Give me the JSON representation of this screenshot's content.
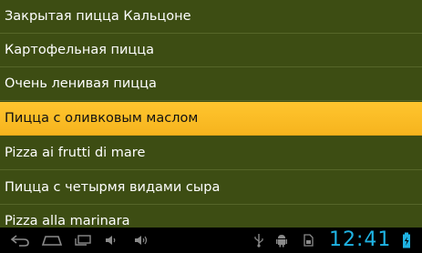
{
  "list": {
    "items": [
      {
        "label": "Закрытая пицца Кальцоне",
        "selected": false
      },
      {
        "label": "Картофельная пицца",
        "selected": false
      },
      {
        "label": "Очень ленивая пицца",
        "selected": false
      },
      {
        "label": "Пицца с оливковым маслом",
        "selected": true
      },
      {
        "label": "Pizza ai frutti di mare",
        "selected": false
      },
      {
        "label": "Пицца с четырмя видами сыра",
        "selected": false
      },
      {
        "label": "Pizza alla marinara",
        "selected": false
      }
    ]
  },
  "navbar": {
    "buttons": [
      "back-icon",
      "home-icon",
      "recent-apps-icon",
      "volume-down-icon",
      "volume-up-icon"
    ],
    "status_icons": [
      "usb-icon",
      "android-debug-icon",
      "sd-card-icon"
    ],
    "clock": "12:41",
    "battery": "battery-charging-icon"
  },
  "colors": {
    "list_background": "#3d4d13",
    "selected_background": "#fbbd26",
    "divider": "#566629",
    "text": "#ffffff",
    "navbar_background": "#000000",
    "clock": "#1fb3e3",
    "nav_icon": "#8a8a8a"
  }
}
